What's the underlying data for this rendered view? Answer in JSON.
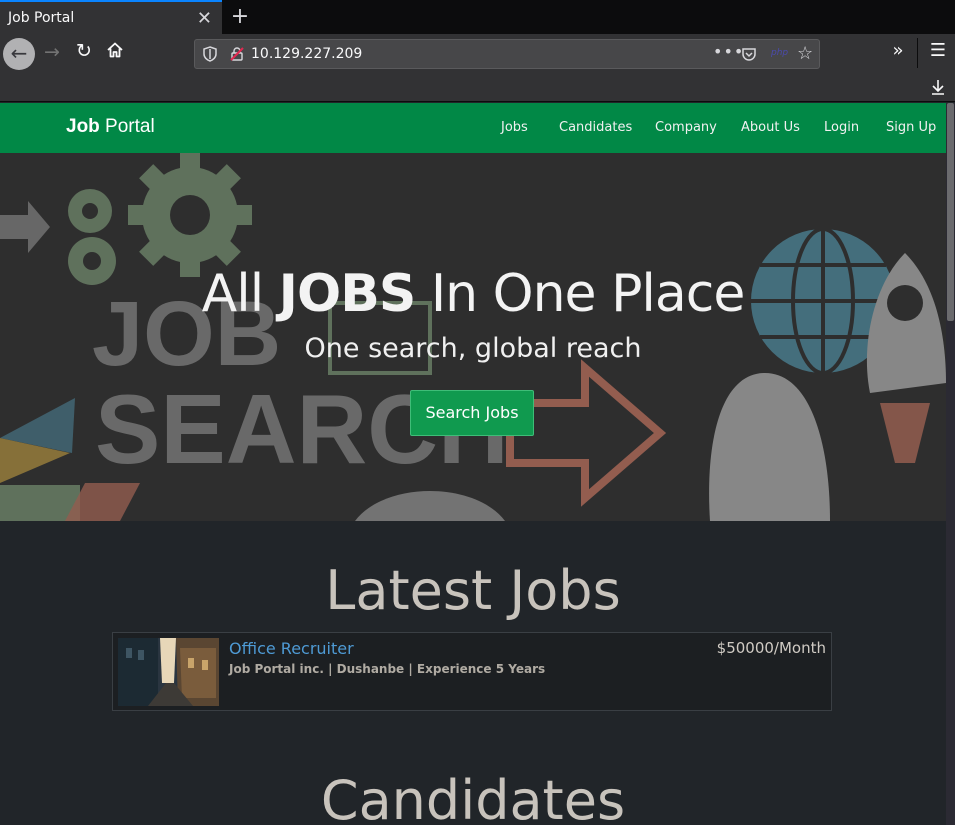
{
  "browser": {
    "tab_title": "Job Portal",
    "tab_close": "✕",
    "new_tab": "+",
    "url": "10.129.227.209",
    "url_menu": "•••",
    "url_php_badge": "php"
  },
  "site": {
    "brand_bold": "Job",
    "brand_rest": " Portal",
    "nav": [
      "Jobs",
      "Candidates",
      "Company",
      "About Us",
      "Login",
      "Sign Up"
    ],
    "colors": {
      "navbar": "#018846",
      "button": "#109a4f",
      "link": "#4e9ad4",
      "background": "#212529"
    }
  },
  "hero": {
    "title_pre": "All ",
    "title_bold": "JOBS",
    "title_post": " In One Place",
    "subtitle": "One search, global reach",
    "button": "Search Jobs"
  },
  "latest_jobs": {
    "heading": "Latest Jobs",
    "items": [
      {
        "title": "Office Recruiter",
        "meta": "Job Portal inc. | Dushanbe | Experience 5 Years",
        "salary": "$50000/Month"
      }
    ]
  },
  "candidates": {
    "heading": "Candidates"
  }
}
